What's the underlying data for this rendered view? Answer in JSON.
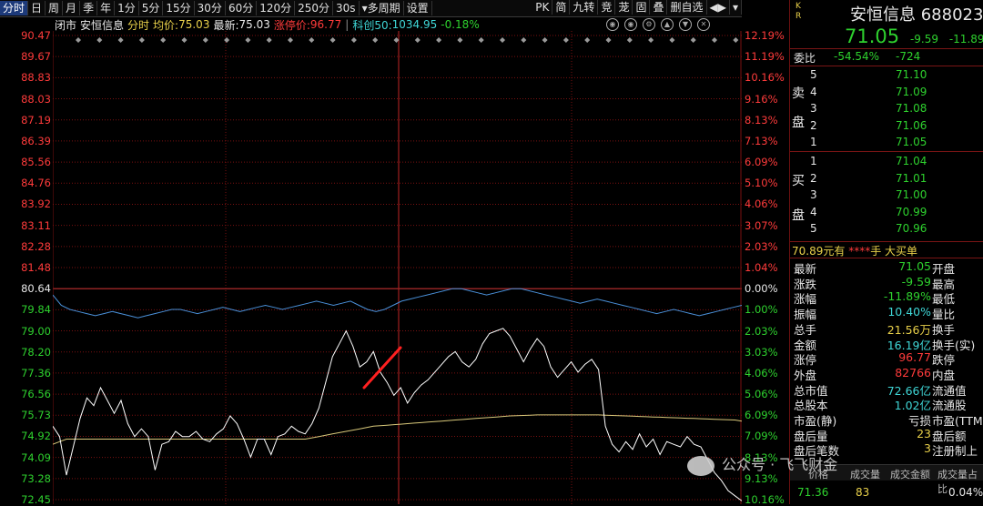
{
  "toolbar": {
    "period_buttons": [
      "分时",
      "日",
      "周",
      "月",
      "季",
      "年",
      "1分",
      "5分",
      "15分",
      "30分",
      "60分",
      "120分",
      "250分",
      "30s"
    ],
    "multi_period": "多周期",
    "settings": "设置",
    "right_buttons": [
      "PK",
      "简",
      "九转",
      "竞",
      "茏",
      "固",
      "叠",
      "删自选"
    ]
  },
  "infobar": {
    "status": "闭市",
    "name": "安恒信息",
    "chart_type": "分时",
    "avg_label": "均价:",
    "avg_value": "75.03",
    "last_label": "最新:",
    "last_value": "75.03",
    "limit_label": "涨停价:",
    "limit_value": "96.77",
    "index_label": "科创50:",
    "index_value": "1034.95",
    "index_change": "-0.18%"
  },
  "axis": {
    "left": [
      "90.47",
      "89.67",
      "88.83",
      "88.03",
      "87.19",
      "86.39",
      "85.56",
      "84.76",
      "83.92",
      "83.11",
      "82.28",
      "81.48",
      "80.64",
      "79.84",
      "79.00",
      "78.20",
      "77.36",
      "76.56",
      "75.73",
      "74.92",
      "74.09",
      "73.28",
      "72.45"
    ],
    "right": [
      "12.19%",
      "11.19%",
      "10.16%",
      "9.16%",
      "8.13%",
      "7.13%",
      "6.09%",
      "5.10%",
      "4.06%",
      "3.07%",
      "2.03%",
      "1.04%",
      "0.00%",
      "1.00%",
      "2.03%",
      "3.03%",
      "4.06%",
      "5.06%",
      "6.09%",
      "7.09%",
      "8.13%",
      "9.13%",
      "10.16%"
    ]
  },
  "colors": {
    "up": "#ff3b3b",
    "down": "#2ed12e",
    "grid": "#7a1010",
    "price_line": "#ffffff",
    "avg_line": "#d8c87a",
    "index_line": "#4a90d9"
  },
  "chart_data": {
    "type": "line",
    "series": [
      {
        "values": [
          75.3,
          74.9,
          73.4,
          74.5,
          75.6,
          76.4,
          76.1,
          76.8,
          76.3,
          75.8,
          76.3,
          75.4,
          74.9,
          75.2,
          74.9,
          73.6,
          74.6,
          74.7,
          75.1,
          74.9,
          74.9,
          75.1,
          74.8,
          74.7,
          75.0,
          75.2,
          75.7,
          75.4,
          74.8,
          74.1,
          74.8,
          74.8,
          74.2,
          74.9,
          75.0,
          75.3,
          75.1,
          75.0,
          75.4,
          76.0,
          77.0,
          78.0,
          78.5,
          79.0,
          78.4,
          77.6,
          77.8,
          78.2,
          77.4,
          77.0,
          76.5,
          76.8,
          76.2,
          76.6,
          76.9,
          77.1,
          77.4,
          77.7,
          78.0,
          78.2,
          77.8,
          77.6,
          77.9,
          78.5,
          78.9,
          79.0,
          79.1,
          78.8,
          78.3,
          77.8,
          78.3,
          78.7,
          78.4,
          77.6,
          77.2,
          77.5,
          77.8,
          77.4,
          77.7,
          77.9,
          77.5,
          75.3,
          74.6,
          74.3,
          74.7,
          74.4,
          75.0,
          74.5,
          74.8,
          74.2,
          74.7,
          74.6,
          74.5,
          74.9,
          74.6,
          74.5,
          74.0,
          73.5,
          73.2,
          72.8,
          72.6,
          72.4
        ]
      },
      {
        "values": [
          74.6,
          74.7,
          74.8,
          74.8,
          74.8,
          74.8,
          74.8,
          74.8,
          74.8,
          74.8,
          74.8,
          74.8,
          74.8,
          74.8,
          74.8,
          74.8,
          74.8,
          74.8,
          74.8,
          74.8,
          74.8,
          74.8,
          74.8,
          74.8,
          74.8,
          74.8,
          74.8,
          74.8,
          74.8,
          74.8,
          74.8,
          74.8,
          74.8,
          74.8,
          74.8,
          74.8,
          74.8,
          74.8,
          74.85,
          74.9,
          74.95,
          75.0,
          75.05,
          75.1,
          75.15,
          75.2,
          75.25,
          75.3,
          75.32,
          75.34,
          75.36,
          75.38,
          75.4,
          75.42,
          75.44,
          75.46,
          75.48,
          75.5,
          75.52,
          75.54,
          75.56,
          75.58,
          75.6,
          75.62,
          75.64,
          75.66,
          75.68,
          75.7,
          75.71,
          75.72,
          75.73,
          75.74,
          75.74,
          75.74,
          75.74,
          75.74,
          75.74,
          75.74,
          75.74,
          75.74,
          75.74,
          75.73,
          75.72,
          75.71,
          75.7,
          75.69,
          75.68,
          75.67,
          75.66,
          75.65,
          75.64,
          75.63,
          75.62,
          75.61,
          75.6,
          75.59,
          75.58,
          75.57,
          75.56,
          75.55,
          75.54,
          75.5
        ]
      },
      {
        "values": [
          -0.3,
          -0.8,
          -1.0,
          -1.1,
          -1.2,
          -1.3,
          -1.2,
          -1.1,
          -1.2,
          -1.3,
          -1.4,
          -1.3,
          -1.2,
          -1.1,
          -1.0,
          -1.0,
          -1.1,
          -1.2,
          -1.1,
          -1.0,
          -0.9,
          -1.0,
          -1.1,
          -1.0,
          -0.9,
          -0.8,
          -0.9,
          -1.0,
          -0.9,
          -0.8,
          -0.7,
          -0.6,
          -0.7,
          -0.8,
          -0.7,
          -0.6,
          -0.8,
          -1.0,
          -1.1,
          -1.0,
          -0.8,
          -0.6,
          -0.5,
          -0.4,
          -0.3,
          -0.2,
          -0.1,
          0.0,
          0.0,
          -0.1,
          -0.2,
          -0.3,
          -0.2,
          -0.1,
          0.0,
          0.0,
          -0.1,
          -0.2,
          -0.3,
          -0.4,
          -0.5,
          -0.6,
          -0.7,
          -0.6,
          -0.5,
          -0.6,
          -0.7,
          -0.8,
          -0.9,
          -1.0,
          -1.1,
          -1.2,
          -1.1,
          -1.0,
          -1.1,
          -1.2,
          -1.3,
          -1.2,
          -1.1,
          -1.0,
          -0.9,
          -0.8
        ]
      }
    ],
    "ylim": [
      72.45,
      90.47
    ],
    "ref_price": 80.64,
    "grid": true
  },
  "panel": {
    "kr": [
      "K",
      "R"
    ],
    "name": "安恒信息",
    "code": "688023",
    "price": "71.05",
    "change": "-9.59",
    "change_pct": "-11.89%",
    "weibi_label": "委比",
    "weibi_pct": "-54.54%",
    "weibi_val": "-724",
    "sell_label": [
      "卖",
      "盘"
    ],
    "buy_label": [
      "买",
      "盘"
    ],
    "sell": [
      {
        "lv": "5",
        "price": "71.10"
      },
      {
        "lv": "4",
        "price": "71.09"
      },
      {
        "lv": "3",
        "price": "71.08"
      },
      {
        "lv": "2",
        "price": "71.06"
      },
      {
        "lv": "1",
        "price": "71.05"
      }
    ],
    "buy": [
      {
        "lv": "1",
        "price": "71.04"
      },
      {
        "lv": "2",
        "price": "71.01"
      },
      {
        "lv": "3",
        "price": "71.00"
      },
      {
        "lv": "4",
        "price": "70.99"
      },
      {
        "lv": "5",
        "price": "70.96"
      }
    ],
    "big_order": {
      "p1": "70.89",
      "p2": "元有",
      "p3": "****",
      "p4": "手",
      "p5": "大买单"
    },
    "stats": [
      {
        "k": "最新",
        "v": "71.05",
        "c": "#2ed12e",
        "k2": "开盘"
      },
      {
        "k": "涨跌",
        "v": "-9.59",
        "c": "#2ed12e",
        "k2": "最高"
      },
      {
        "k": "涨幅",
        "v": "-11.89%",
        "c": "#2ed12e",
        "k2": "最低"
      },
      {
        "k": "振幅",
        "v": "10.40%",
        "c": "#3fd6d6",
        "k2": "量比"
      },
      {
        "k": "总手",
        "v": "21.56万",
        "c": "#e8d04a",
        "k2": "换手"
      },
      {
        "k": "金额",
        "v": "16.19亿",
        "c": "#3fd6d6",
        "k2": "换手(实)"
      },
      {
        "k": "涨停",
        "v": "96.77",
        "c": "#ff3b3b",
        "k2": "跌停"
      },
      {
        "k": "外盘",
        "v": "82766",
        "c": "#ff3b3b",
        "k2": "内盘"
      },
      {
        "k": "总市值",
        "v": "72.66亿",
        "c": "#3fd6d6",
        "k2": "流通值"
      },
      {
        "k": "总股本",
        "v": "1.02亿",
        "c": "#3fd6d6",
        "k2": "流通股"
      },
      {
        "k": "市盈(静)",
        "v": "亏损",
        "c": "#e8e8e8",
        "k2": "市盈(TTM)"
      },
      {
        "k": "盘后量",
        "v": "23",
        "c": "#e8d04a",
        "k2": "盘后额"
      },
      {
        "k": "盘后笔数",
        "v": "3",
        "c": "#e8d04a",
        "k2": "注册制上"
      }
    ],
    "trade_head": [
      "价格",
      "成交量",
      "成交金额",
      "成交量占比"
    ],
    "trade_row": {
      "price": "71.36",
      "vol": "83",
      "pct": "0.04%"
    }
  },
  "watermark": "公众号 · 飞飞财金"
}
